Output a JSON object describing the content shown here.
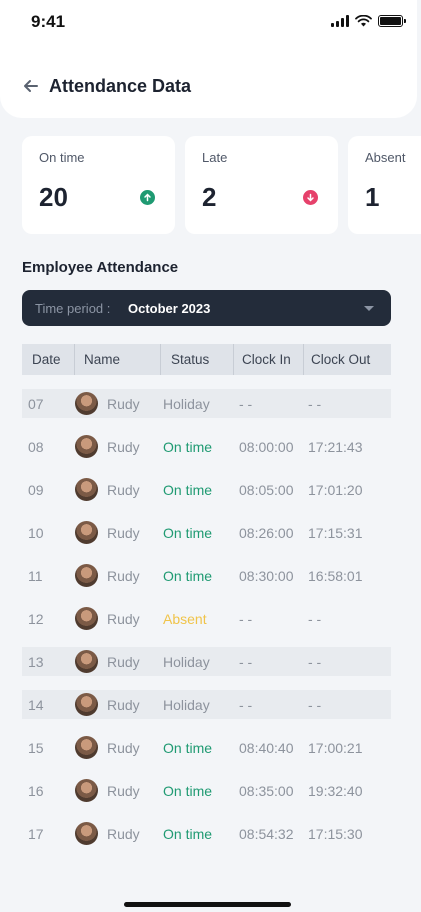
{
  "status_bar": {
    "time": "9:41"
  },
  "header": {
    "title": "Attendance Data"
  },
  "stats": [
    {
      "label": "On time",
      "value": "20",
      "color": "#1f9a72",
      "icon": "arrow-up-icon"
    },
    {
      "label": "Late",
      "value": "2",
      "color": "#e6416b",
      "icon": "arrow-down-icon"
    },
    {
      "label": "Absent",
      "value": "1"
    }
  ],
  "section_title": "Employee Attendance",
  "period": {
    "label": "Time period :",
    "value": "October 2023"
  },
  "table": {
    "columns": [
      "Date",
      "Name",
      "Status",
      "Clock In",
      "Clock Out"
    ],
    "rows": [
      {
        "date": "07",
        "name": "Rudy",
        "status": "Holiday",
        "clock_in": "- -",
        "clock_out": "- -"
      },
      {
        "date": "08",
        "name": "Rudy",
        "status": "On time",
        "clock_in": "08:00:00",
        "clock_out": "17:21:43"
      },
      {
        "date": "09",
        "name": "Rudy",
        "status": "On time",
        "clock_in": "08:05:00",
        "clock_out": "17:01:20"
      },
      {
        "date": "10",
        "name": "Rudy",
        "status": "On time",
        "clock_in": "08:26:00",
        "clock_out": "17:15:31"
      },
      {
        "date": "11",
        "name": "Rudy",
        "status": "On time",
        "clock_in": "08:30:00",
        "clock_out": "16:58:01"
      },
      {
        "date": "12",
        "name": "Rudy",
        "status": "Absent",
        "clock_in": "- -",
        "clock_out": "- -"
      },
      {
        "date": "13",
        "name": "Rudy",
        "status": "Holiday",
        "clock_in": "- -",
        "clock_out": "- -"
      },
      {
        "date": "14",
        "name": "Rudy",
        "status": "Holiday",
        "clock_in": "- -",
        "clock_out": "- -"
      },
      {
        "date": "15",
        "name": "Rudy",
        "status": "On time",
        "clock_in": "08:40:40",
        "clock_out": "17:00:21"
      },
      {
        "date": "16",
        "name": "Rudy",
        "status": "On time",
        "clock_in": "08:35:00",
        "clock_out": "19:32:40"
      },
      {
        "date": "17",
        "name": "Rudy",
        "status": "On time",
        "clock_in": "08:54:32",
        "clock_out": "17:15:30"
      }
    ]
  }
}
